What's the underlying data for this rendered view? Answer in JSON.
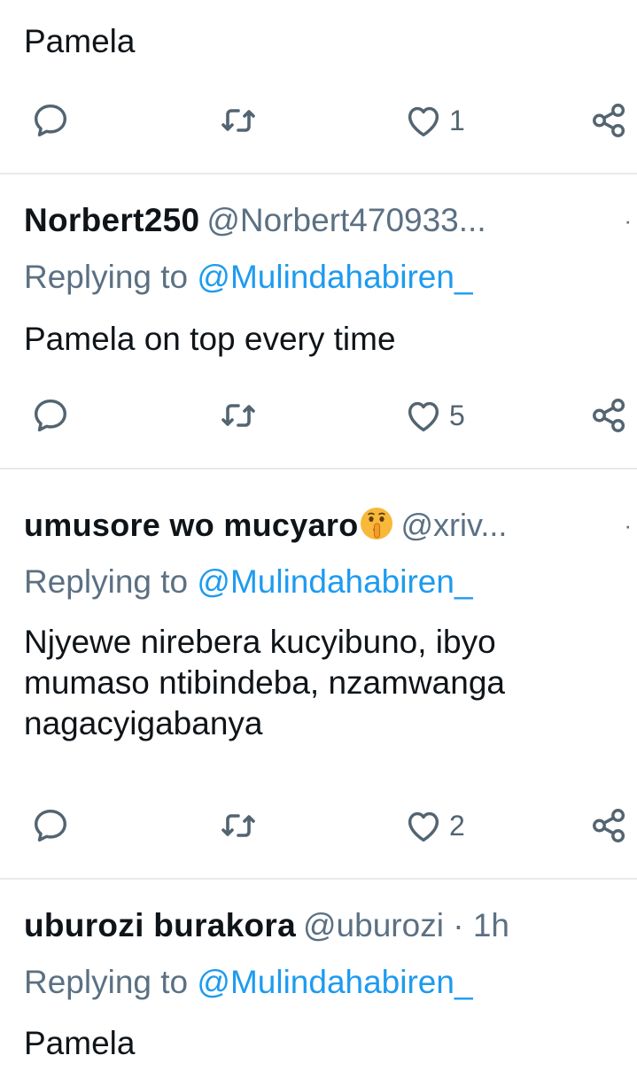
{
  "tweets": [
    {
      "body": "Pamela",
      "actions": {
        "reply": "",
        "retweet": "",
        "like": "1"
      }
    },
    {
      "name": "Norbert250",
      "handle": "@Norbert470933...",
      "reply_prefix": "Replying to",
      "reply_to": "@Mulindahabiren_",
      "body": "Pamela on top every time",
      "actions": {
        "reply": "",
        "retweet": "",
        "like": "5"
      }
    },
    {
      "name": "umusore wo mucyaro",
      "name_emoji": "shushing-face-emoji",
      "handle": "@xriv...",
      "reply_prefix": "Replying to",
      "reply_to": "@Mulindahabiren_",
      "body_lines": [
        "Njyewe nirebera kucyibuno, ibyo",
        "mumaso ntibindeba, nzamwanga",
        "nagacyigabanya"
      ],
      "actions": {
        "reply": "",
        "retweet": "",
        "like": "2"
      }
    },
    {
      "name": "uburozi burakora",
      "handle": "@uburozi",
      "time_sep": "·",
      "time": "1h",
      "reply_prefix": "Replying to",
      "reply_to": "@Mulindahabiren_",
      "body": "Pamela"
    }
  ],
  "colors": {
    "text": "#0f1419",
    "muted": "#5b7083",
    "link": "#1d9bf0",
    "divider": "#e6e9ec"
  }
}
